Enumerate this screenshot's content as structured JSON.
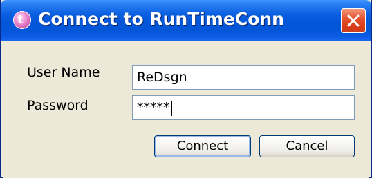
{
  "window": {
    "title": "Connect to RunTimeConn",
    "app_icon": "runtime-app-icon",
    "close_icon": "close-icon"
  },
  "form": {
    "username_label": "User Name",
    "username_value": "ReDsgn",
    "password_label": "Password",
    "password_value": "*****"
  },
  "buttons": {
    "connect_label": "Connect",
    "cancel_label": "Cancel"
  },
  "colors": {
    "titlebar": "#0456d8",
    "close_button": "#d63b18",
    "dialog_background": "#ece9d8"
  }
}
